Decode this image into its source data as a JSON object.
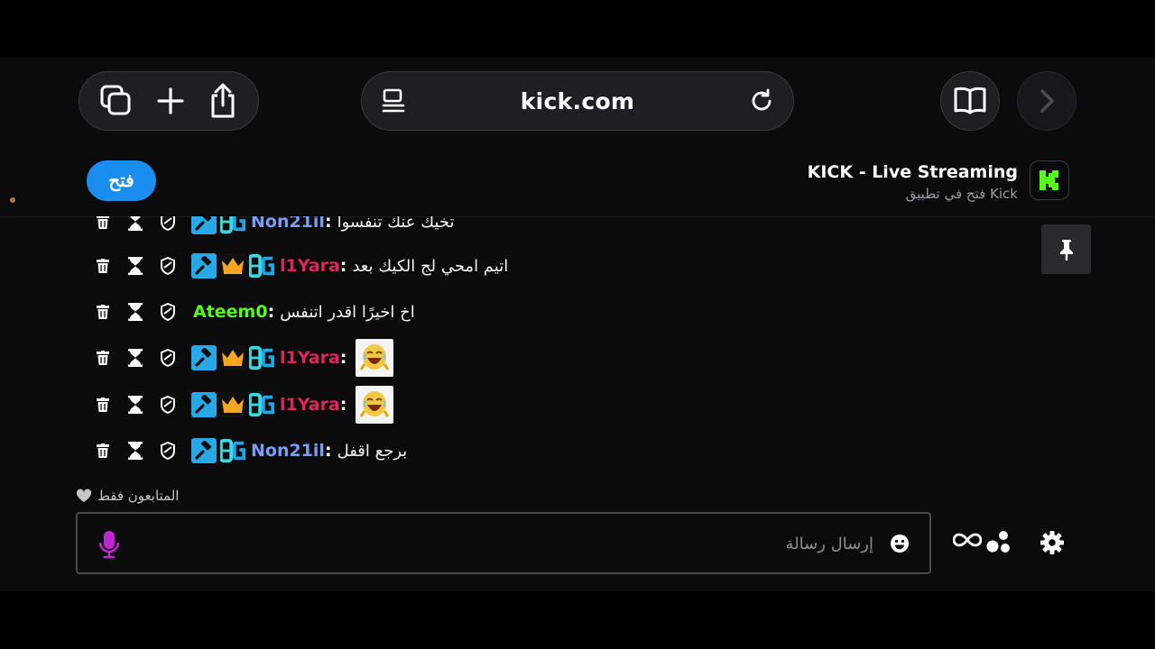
{
  "browser": {
    "url": "kick.com",
    "icons": {
      "tabs": "tabs-icon",
      "new_tab": "plus-icon",
      "share": "share-icon",
      "reader": "reader-mode-icon",
      "reload": "reload-icon",
      "bookmarks": "book-icon",
      "forward": "chevron-right-icon"
    }
  },
  "banner": {
    "open_label": "فتح",
    "app_title": "KICK - Live Streaming",
    "app_subtitle": "فتح في تطبيق Kick",
    "accent": "#1a8ef0",
    "logo_color": "#53fc18"
  },
  "chat": {
    "messages": [
      {
        "badges": [
          "hammer",
          "og"
        ],
        "username": "Non21il",
        "color": "#7b9cf5",
        "text": "تخيك عنك تنفسوا"
      },
      {
        "badges": [
          "hammer",
          "crown",
          "og"
        ],
        "username": "l1Yara",
        "color": "#e0245e",
        "text": "اتيم امحي لج الكيك بعد"
      },
      {
        "badges": [],
        "username": "Ateem0",
        "color": "#53fc18",
        "text": "اخ اخيرًا اقدر اتنفس"
      },
      {
        "badges": [
          "hammer",
          "crown",
          "og"
        ],
        "username": "l1Yara",
        "color": "#e0245e",
        "text": "",
        "emote": "laughing-emote"
      },
      {
        "badges": [
          "hammer",
          "crown",
          "og"
        ],
        "username": "l1Yara",
        "color": "#e0245e",
        "text": "",
        "emote": "laughing-emote"
      },
      {
        "badges": [
          "hammer",
          "og"
        ],
        "username": "Non21il",
        "color": "#7b9cf5",
        "text": "برجع اقفل"
      }
    ]
  },
  "footer": {
    "followers_only": "المتابعون فقط",
    "placeholder": "إرسال رسالة"
  }
}
